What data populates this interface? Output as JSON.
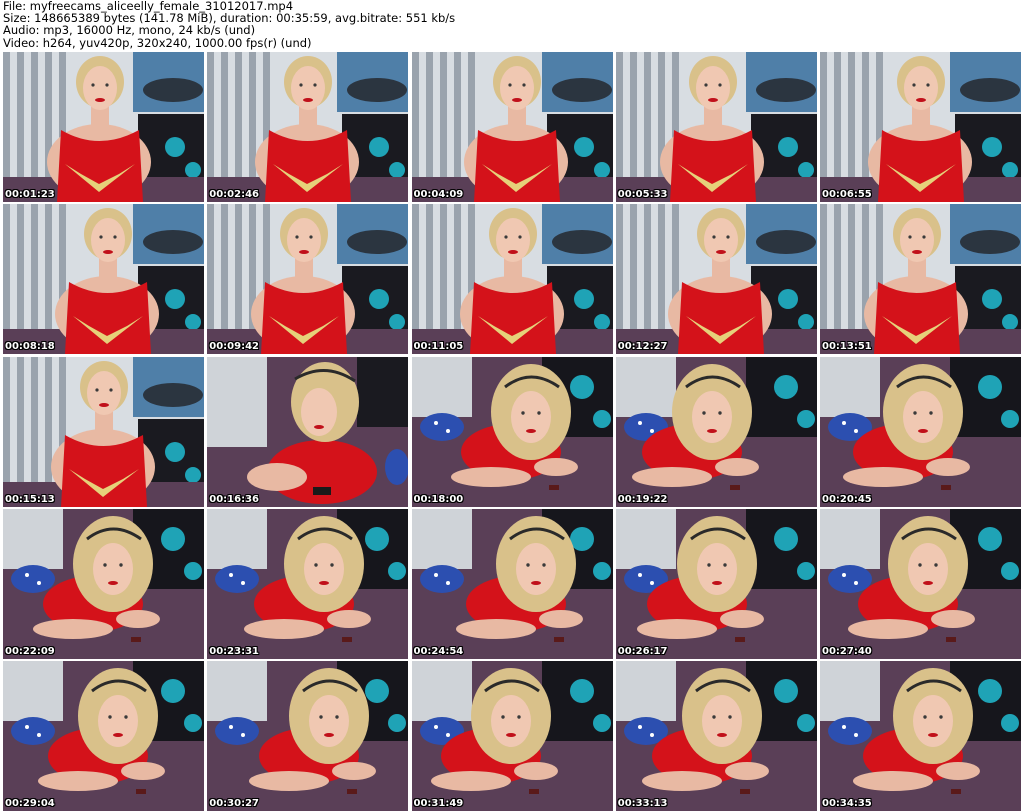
{
  "header": {
    "file_line": "File: myfreecams_aliceelly_female_31012017.mp4",
    "size_line": "Size: 148665389 bytes (141.78 MiB), duration: 00:35:59, avg.bitrate: 551 kb/s",
    "audio_line": "Audio: mp3, 16000 Hz, mono, 24 kb/s (und)",
    "video_line": "Video: h264, yuv420p, 320x240, 1000.00 fps(r) (und)"
  },
  "thumbnails": [
    {
      "timestamp": "00:01:23",
      "scene": "sitting"
    },
    {
      "timestamp": "00:02:46",
      "scene": "sitting"
    },
    {
      "timestamp": "00:04:09",
      "scene": "sitting"
    },
    {
      "timestamp": "00:05:33",
      "scene": "sitting"
    },
    {
      "timestamp": "00:06:55",
      "scene": "sitting"
    },
    {
      "timestamp": "00:08:18",
      "scene": "sitting"
    },
    {
      "timestamp": "00:09:42",
      "scene": "sitting"
    },
    {
      "timestamp": "00:11:05",
      "scene": "sitting"
    },
    {
      "timestamp": "00:12:27",
      "scene": "sitting"
    },
    {
      "timestamp": "00:13:51",
      "scene": "sitting"
    },
    {
      "timestamp": "00:15:13",
      "scene": "sitting"
    },
    {
      "timestamp": "00:16:36",
      "scene": "leaning"
    },
    {
      "timestamp": "00:18:00",
      "scene": "lying"
    },
    {
      "timestamp": "00:19:22",
      "scene": "lying"
    },
    {
      "timestamp": "00:20:45",
      "scene": "lying"
    },
    {
      "timestamp": "00:22:09",
      "scene": "lying"
    },
    {
      "timestamp": "00:23:31",
      "scene": "lying"
    },
    {
      "timestamp": "00:24:54",
      "scene": "lying"
    },
    {
      "timestamp": "00:26:17",
      "scene": "lying"
    },
    {
      "timestamp": "00:27:40",
      "scene": "lying"
    },
    {
      "timestamp": "00:29:04",
      "scene": "lying"
    },
    {
      "timestamp": "00:30:27",
      "scene": "lying"
    },
    {
      "timestamp": "00:31:49",
      "scene": "lying"
    },
    {
      "timestamp": "00:33:13",
      "scene": "lying"
    },
    {
      "timestamp": "00:34:35",
      "scene": "lying"
    }
  ]
}
